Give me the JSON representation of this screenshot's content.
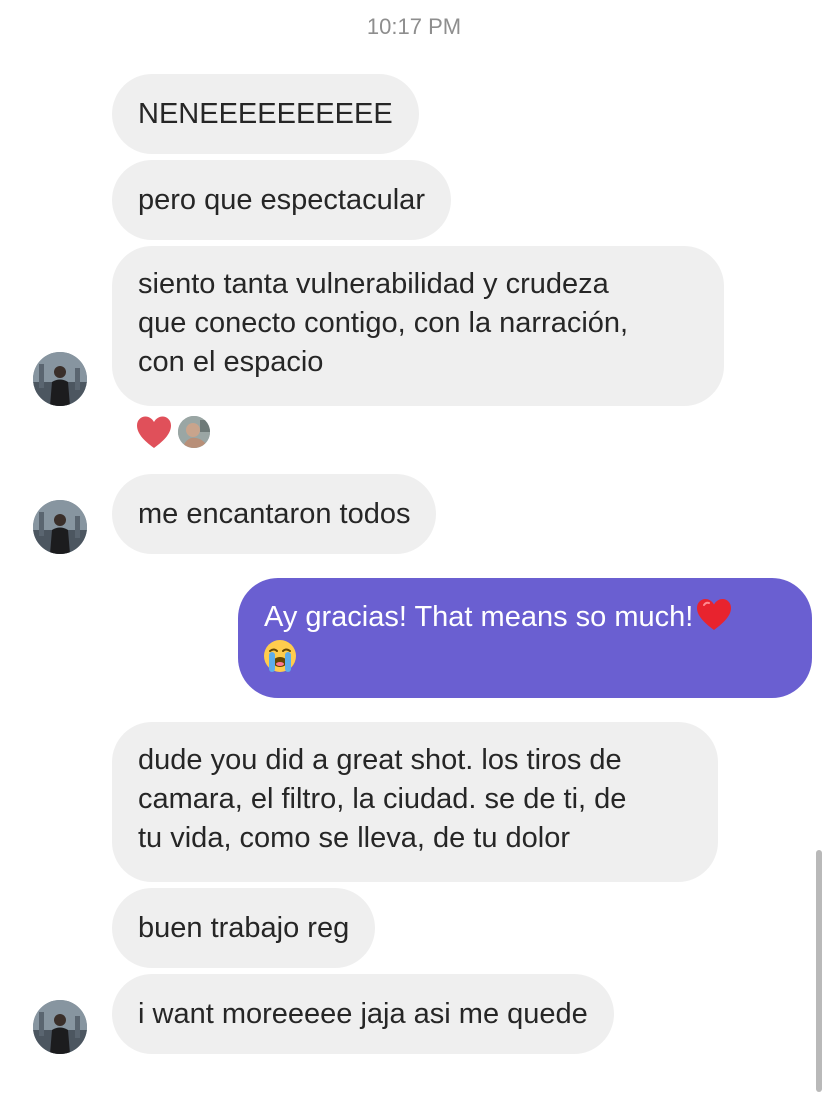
{
  "thread": {
    "timestamp": "10:17 PM",
    "messages": [
      {
        "sender": "other",
        "text": "NENEEEEEEEEEE"
      },
      {
        "sender": "other",
        "text": "pero que espectacular"
      },
      {
        "sender": "other",
        "lines": [
          "siento tanta vulnerabilidad y crudeza",
          "que conecto contigo, con la narración,",
          "con el espacio"
        ]
      },
      {
        "sender": "other",
        "text": "me encantaron todos"
      },
      {
        "sender": "me",
        "lines": [
          "Ay gracias! That means so much!"
        ]
      },
      {
        "sender": "other",
        "lines": [
          "dude you did a great shot. los tiros de",
          "camara, el filtro, la ciudad. se de ti, de",
          "tu vida, como se lleva, de tu dolor"
        ]
      },
      {
        "sender": "other",
        "text": "buen trabajo reg"
      },
      {
        "sender": "other",
        "text": "i want moreeeee jaja asi me quede"
      }
    ],
    "reactions": [
      "heart-icon",
      "reactor-avatar"
    ],
    "sent_emojis": [
      "red-heart-emoji",
      "loudly-crying-face-emoji"
    ]
  },
  "colors": {
    "received_bubble": "#efefef",
    "sent_bubble": "#6a5fd1",
    "text": "#262626",
    "timestamp": "#8e8e8e",
    "heart": "#e0505a"
  }
}
